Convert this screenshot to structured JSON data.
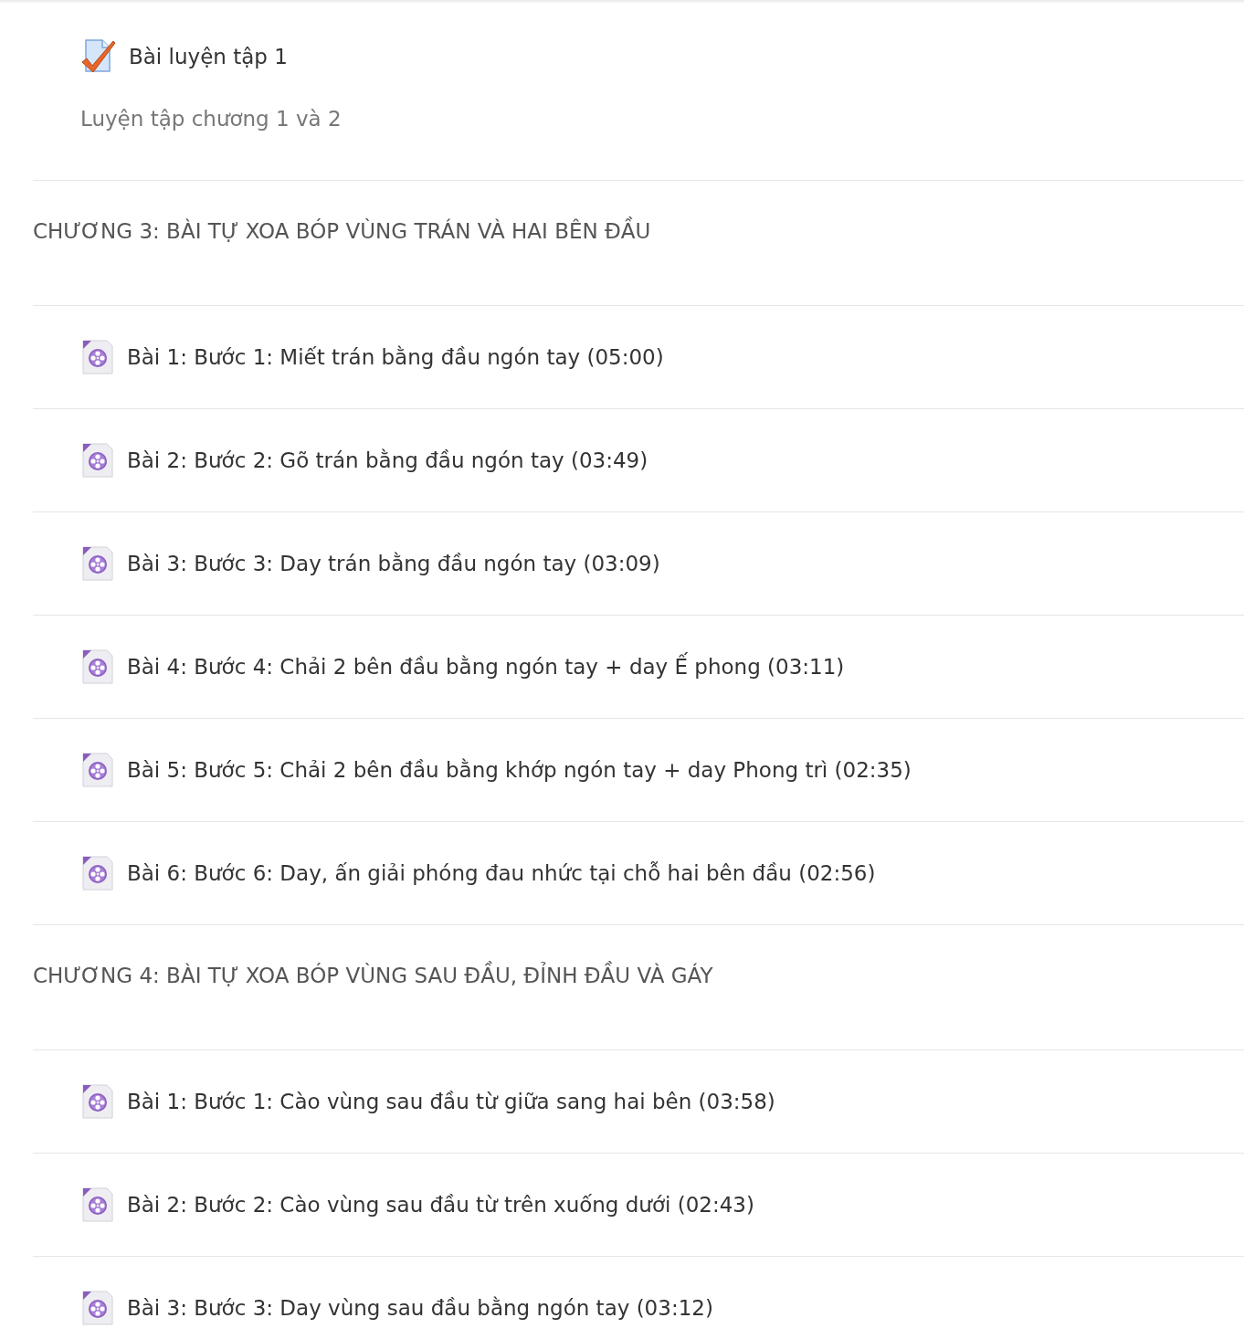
{
  "sections": [
    {
      "items": [
        {
          "kind": "quiz",
          "title": "Bài luyện tập 1",
          "description": "Luyện tập chương 1 và 2"
        }
      ]
    },
    {
      "heading": "CHƯƠNG 3: BÀI TỰ XOA BÓP VÙNG TRÁN VÀ HAI BÊN ĐẦU",
      "items": [
        {
          "kind": "video",
          "title": "Bài 1: Bước 1: Miết trán bằng đầu ngón tay (05:00)"
        },
        {
          "kind": "video",
          "title": "Bài 2: Bước 2: Gõ trán bằng đầu ngón tay (03:49)"
        },
        {
          "kind": "video",
          "title": "Bài 3: Bước 3: Day trán bằng đầu ngón tay (03:09)"
        },
        {
          "kind": "video",
          "title": "Bài 4: Bước 4: Chải 2 bên đầu bằng ngón tay + day Ế phong (03:11)"
        },
        {
          "kind": "video",
          "title": "Bài 5: Bước 5: Chải 2 bên đầu bằng khớp ngón tay + day Phong trì (02:35)"
        },
        {
          "kind": "video",
          "title": "Bài 6: Bước 6: Day, ấn giải phóng đau nhức tại chỗ hai bên đầu (02:56)"
        }
      ]
    },
    {
      "heading": "CHƯƠNG 4: BÀI TỰ XOA BÓP VÙNG SAU ĐẦU, ĐỈNH ĐẦU VÀ GÁY",
      "items": [
        {
          "kind": "video",
          "title": "Bài 1: Bước 1: Cào vùng sau đầu từ giữa sang hai bên (03:58)"
        },
        {
          "kind": "video",
          "title": "Bài 2: Bước 2: Cào vùng sau đầu từ trên xuống dưới (02:43)"
        },
        {
          "kind": "video",
          "title": "Bài 3: Bước 3: Day vùng sau đầu bằng ngón tay (03:12)"
        }
      ]
    }
  ]
}
